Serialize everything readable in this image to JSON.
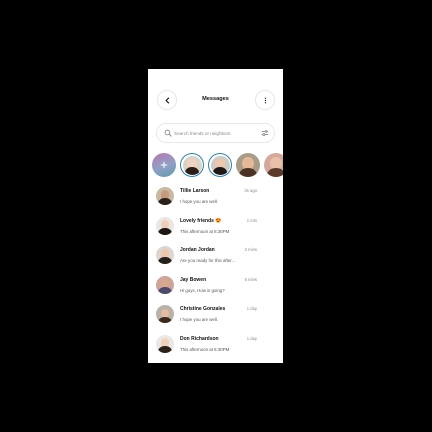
{
  "header": {
    "title": "Messages"
  },
  "search": {
    "placeholder": "Search friends or neighbors"
  },
  "stories": [
    {
      "type": "add"
    },
    {
      "type": "ring",
      "bg": "#d9d2c6",
      "skin": "#f0d2bd",
      "hair": "#2a1d17"
    },
    {
      "type": "ring",
      "bg": "#cfcac4",
      "skin": "#ecc8b0",
      "hair": "#1e1915"
    },
    {
      "type": "plain",
      "bg": "#a89c88",
      "skin": "#e4b898",
      "hair": "#4a3322"
    },
    {
      "type": "plain",
      "bg": "#d6a79c",
      "skin": "#e7c1a8",
      "hair": "#5a3b2c"
    }
  ],
  "conversations": [
    {
      "name": "Tillie Larson",
      "time": "3s ago",
      "preview": "I hope you are well.",
      "bg": "#c9b9a3",
      "skin": "#c89a7b",
      "hair": "#2b211b"
    },
    {
      "name": "Lovely friends 😍",
      "time": "1 min",
      "preview": "This afternoon at 6:30PM",
      "bg": "#e9e6e3",
      "skin": "#f0cdb6",
      "hair": "#1b1612"
    },
    {
      "name": "Jordan Jordan",
      "time": "2 mins",
      "preview": "Are you ready for this after...",
      "bg": "#ddd6d0",
      "skin": "#ecc7ae",
      "hair": "#27211c"
    },
    {
      "name": "Jay Bowen",
      "time": "5 mins",
      "preview": "Hi guys, How is going?",
      "bg": "#cda59a",
      "skin": "#d9a88c",
      "hair": "#4e4a6b"
    },
    {
      "name": "Christine Gonzales",
      "time": "1 day",
      "preview": "I hope you are well.",
      "bg": "#b8b2a9",
      "skin": "#e3bda2",
      "hair": "#3d2a1f"
    },
    {
      "name": "Don Richardson",
      "time": "1 day",
      "preview": "This afternoon at 6:30PM",
      "bg": "#ebe7e4",
      "skin": "#f1d0ba",
      "hair": "#2a211a"
    }
  ]
}
